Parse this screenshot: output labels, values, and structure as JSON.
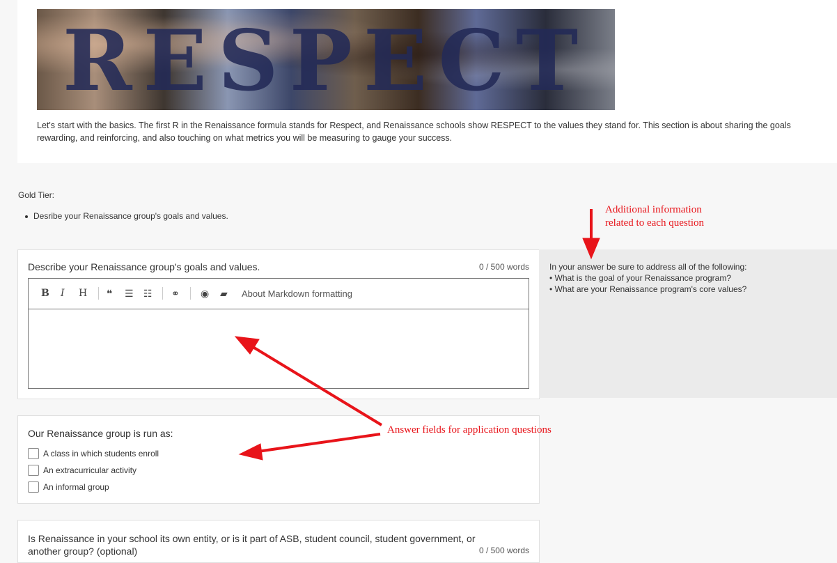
{
  "banner": {
    "word": "RESPECT"
  },
  "intro": {
    "line1": "Let's start with the basics. The first R in the Renaissance formula stands for Respect, and Renaissance schools show RESPECT to the values they stand for. This section is about sharing the goals",
    "line2": "rewarding, and reinforcing, and also touching on what metrics you will be measuring to gauge your success."
  },
  "tier": {
    "label": "Gold Tier:",
    "items": [
      "Desribe your Renaissance group's goals and values."
    ]
  },
  "question1": {
    "title": "Describe your Renaissance group's goals and values.",
    "word_count": "0 / 500 words",
    "toolbar": {
      "bold": "B",
      "italic": "I",
      "heading": "H",
      "quote_icon": "quote-icon",
      "ul_icon": "unordered-list-icon",
      "ol_icon": "ordered-list-icon",
      "link_icon": "link-icon",
      "preview_icon": "eye-icon",
      "guide_icon": "book-icon",
      "markdown_link": "About Markdown formatting"
    },
    "answer_value": ""
  },
  "sidebar": {
    "intro": "In your answer be sure to address all of the following:",
    "items": [
      "• What is the goal of your Renaissance program?",
      "• What are your Renaissance program's core values?"
    ]
  },
  "question2": {
    "title": "Our Renaissance group is run as:",
    "options": [
      {
        "label": "A class in which students enroll",
        "checked": false
      },
      {
        "label": "An extracurricular activity",
        "checked": false
      },
      {
        "label": "An informal group",
        "checked": false
      }
    ]
  },
  "question3": {
    "title_line1": "Is Renaissance in your school its own entity, or is it part of ASB, student council, student government, or",
    "title_line2": "another group? (optional)",
    "word_count": "0 / 500 words"
  },
  "annotations": {
    "additional_line1": "Additional information",
    "additional_line2": "related to each question",
    "answer_fields": "Answer fields for application questions",
    "color": "#e8141a"
  }
}
